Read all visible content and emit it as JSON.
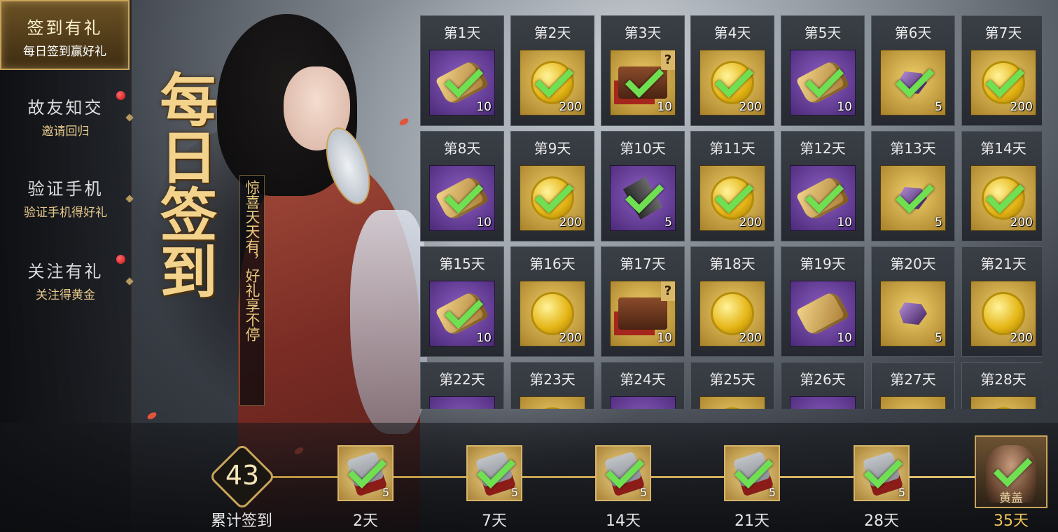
{
  "sidebar": {
    "items": [
      {
        "title": "签到有礼",
        "subtitle": "每日签到赢好礼",
        "active": true,
        "badge": false
      },
      {
        "title": "故友知交",
        "subtitle": "邀请回归",
        "active": false,
        "badge": true
      },
      {
        "title": "验证手机",
        "subtitle": "验证手机得好礼",
        "active": false,
        "badge": false
      },
      {
        "title": "关注有礼",
        "subtitle": "关注得黄金",
        "active": false,
        "badge": true
      }
    ]
  },
  "banner": {
    "headline": "每日签到",
    "tagline": "惊喜天天有，好礼享不停"
  },
  "days": [
    {
      "label": "第1天",
      "item": "scroll",
      "rarity": "purple",
      "qty": "10",
      "claimed": true
    },
    {
      "label": "第2天",
      "item": "coin",
      "rarity": "gold",
      "qty": "200",
      "claimed": true
    },
    {
      "label": "第3天",
      "item": "chest",
      "rarity": "gold",
      "qty": "10",
      "claimed": true
    },
    {
      "label": "第4天",
      "item": "coin",
      "rarity": "gold",
      "qty": "200",
      "claimed": true
    },
    {
      "label": "第5天",
      "item": "scroll",
      "rarity": "purple",
      "qty": "10",
      "claimed": true
    },
    {
      "label": "第6天",
      "item": "gem",
      "rarity": "gold",
      "qty": "5",
      "claimed": true
    },
    {
      "label": "第7天",
      "item": "coin",
      "rarity": "gold",
      "qty": "200",
      "claimed": true
    },
    {
      "label": "第8天",
      "item": "scroll",
      "rarity": "purple",
      "qty": "10",
      "claimed": true
    },
    {
      "label": "第9天",
      "item": "coin",
      "rarity": "gold",
      "qty": "200",
      "claimed": true
    },
    {
      "label": "第10天",
      "item": "book",
      "rarity": "purple",
      "qty": "5",
      "claimed": true
    },
    {
      "label": "第11天",
      "item": "coin",
      "rarity": "gold",
      "qty": "200",
      "claimed": true
    },
    {
      "label": "第12天",
      "item": "scroll",
      "rarity": "purple",
      "qty": "10",
      "claimed": true
    },
    {
      "label": "第13天",
      "item": "gem",
      "rarity": "gold",
      "qty": "5",
      "claimed": true
    },
    {
      "label": "第14天",
      "item": "coin",
      "rarity": "gold",
      "qty": "200",
      "claimed": true
    },
    {
      "label": "第15天",
      "item": "scroll",
      "rarity": "purple",
      "qty": "10",
      "claimed": true
    },
    {
      "label": "第16天",
      "item": "coin",
      "rarity": "gold",
      "qty": "200",
      "claimed": false
    },
    {
      "label": "第17天",
      "item": "chest",
      "rarity": "gold",
      "qty": "10",
      "claimed": false
    },
    {
      "label": "第18天",
      "item": "coin",
      "rarity": "gold",
      "qty": "200",
      "claimed": false
    },
    {
      "label": "第19天",
      "item": "scroll",
      "rarity": "purple",
      "qty": "10",
      "claimed": false
    },
    {
      "label": "第20天",
      "item": "gem",
      "rarity": "gold",
      "qty": "5",
      "claimed": false
    },
    {
      "label": "第21天",
      "item": "coin",
      "rarity": "gold",
      "qty": "200",
      "claimed": false
    },
    {
      "label": "第22天",
      "item": "",
      "rarity": "purple",
      "qty": "",
      "claimed": false
    },
    {
      "label": "第23天",
      "item": "coin",
      "rarity": "gold",
      "qty": "",
      "claimed": false
    },
    {
      "label": "第24天",
      "item": "",
      "rarity": "purple",
      "qty": "",
      "claimed": false
    },
    {
      "label": "第25天",
      "item": "coin",
      "rarity": "gold",
      "qty": "",
      "claimed": false
    },
    {
      "label": "第26天",
      "item": "",
      "rarity": "purple",
      "qty": "",
      "claimed": false
    },
    {
      "label": "第27天",
      "item": "",
      "rarity": "gold",
      "qty": "",
      "claimed": false
    },
    {
      "label": "第28天",
      "item": "coin",
      "rarity": "gold",
      "qty": "",
      "claimed": false
    }
  ],
  "cumulative": {
    "total": "43",
    "total_label": "累计签到",
    "milestones": [
      {
        "label": "2天",
        "qty": "5",
        "claimed": true
      },
      {
        "label": "7天",
        "qty": "5",
        "claimed": true
      },
      {
        "label": "14天",
        "qty": "5",
        "claimed": true
      },
      {
        "label": "21天",
        "qty": "5",
        "claimed": true
      },
      {
        "label": "28天",
        "qty": "5",
        "claimed": true
      }
    ],
    "final": {
      "label": "35天",
      "hero_name": "黄盖",
      "claimed": true
    }
  },
  "colors": {
    "accent_gold": "#c9a45a",
    "check_green": "#6fe051",
    "rarity_purple": "#6a3fa0",
    "rarity_gold": "#d8b14a",
    "badge_red": "#d81818"
  }
}
